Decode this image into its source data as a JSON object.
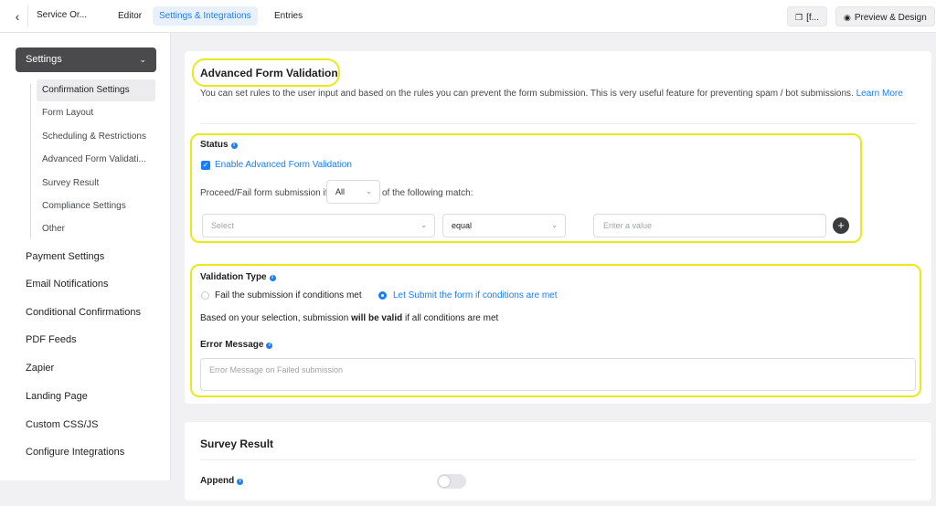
{
  "topbar": {
    "back_icon": "chevron-left-icon",
    "form_title": "Service Or...",
    "tabs": [
      "Editor",
      "Settings & Integrations",
      "Entries"
    ],
    "shortcode_label": "[f...",
    "preview_label": "Preview & Design"
  },
  "sidebar": {
    "settings_label": "Settings",
    "sub_items": [
      "Confirmation Settings",
      "Form Layout",
      "Scheduling & Restrictions",
      "Advanced Form Validati...",
      "Survey Result",
      "Compliance Settings",
      "Other"
    ],
    "main_items": [
      "Payment Settings",
      "Email Notifications",
      "Conditional Confirmations",
      "PDF Feeds",
      "Zapier",
      "Landing Page",
      "Custom CSS/JS",
      "Configure Integrations"
    ]
  },
  "validation": {
    "title": "Advanced Form Validation",
    "description": "You can set rules to the user input and based on the rules you can prevent the form submission. This is very useful feature for preventing spam / bot submissions.",
    "learn_more_1": "Learn",
    "learn_more_2": "More",
    "status_label": "Status",
    "enable_label": "Enable Advanced Form Validation",
    "proceed_prefix": "Proceed/Fail form submission if",
    "match_value": "All",
    "proceed_suffix": "of the following match:",
    "field_placeholder": "Select",
    "operator_value": "equal",
    "value_placeholder": "Enter a value",
    "type_label": "Validation Type",
    "option_fail": "Fail the submission if conditions met",
    "option_submit": "Let Submit the form if conditions are met",
    "result_prefix": "Based on your selection, submission",
    "result_bold": "will be valid",
    "result_suffix": "if all conditions are met",
    "error_label": "Error Message",
    "error_placeholder": "Error Message on Failed submission"
  },
  "survey": {
    "title": "Survey Result",
    "append_label": "Append"
  },
  "colors": {
    "accent": "#1a7efb",
    "highlight": "#e8ea1a",
    "sidebar_active": "#4a4a4c"
  }
}
